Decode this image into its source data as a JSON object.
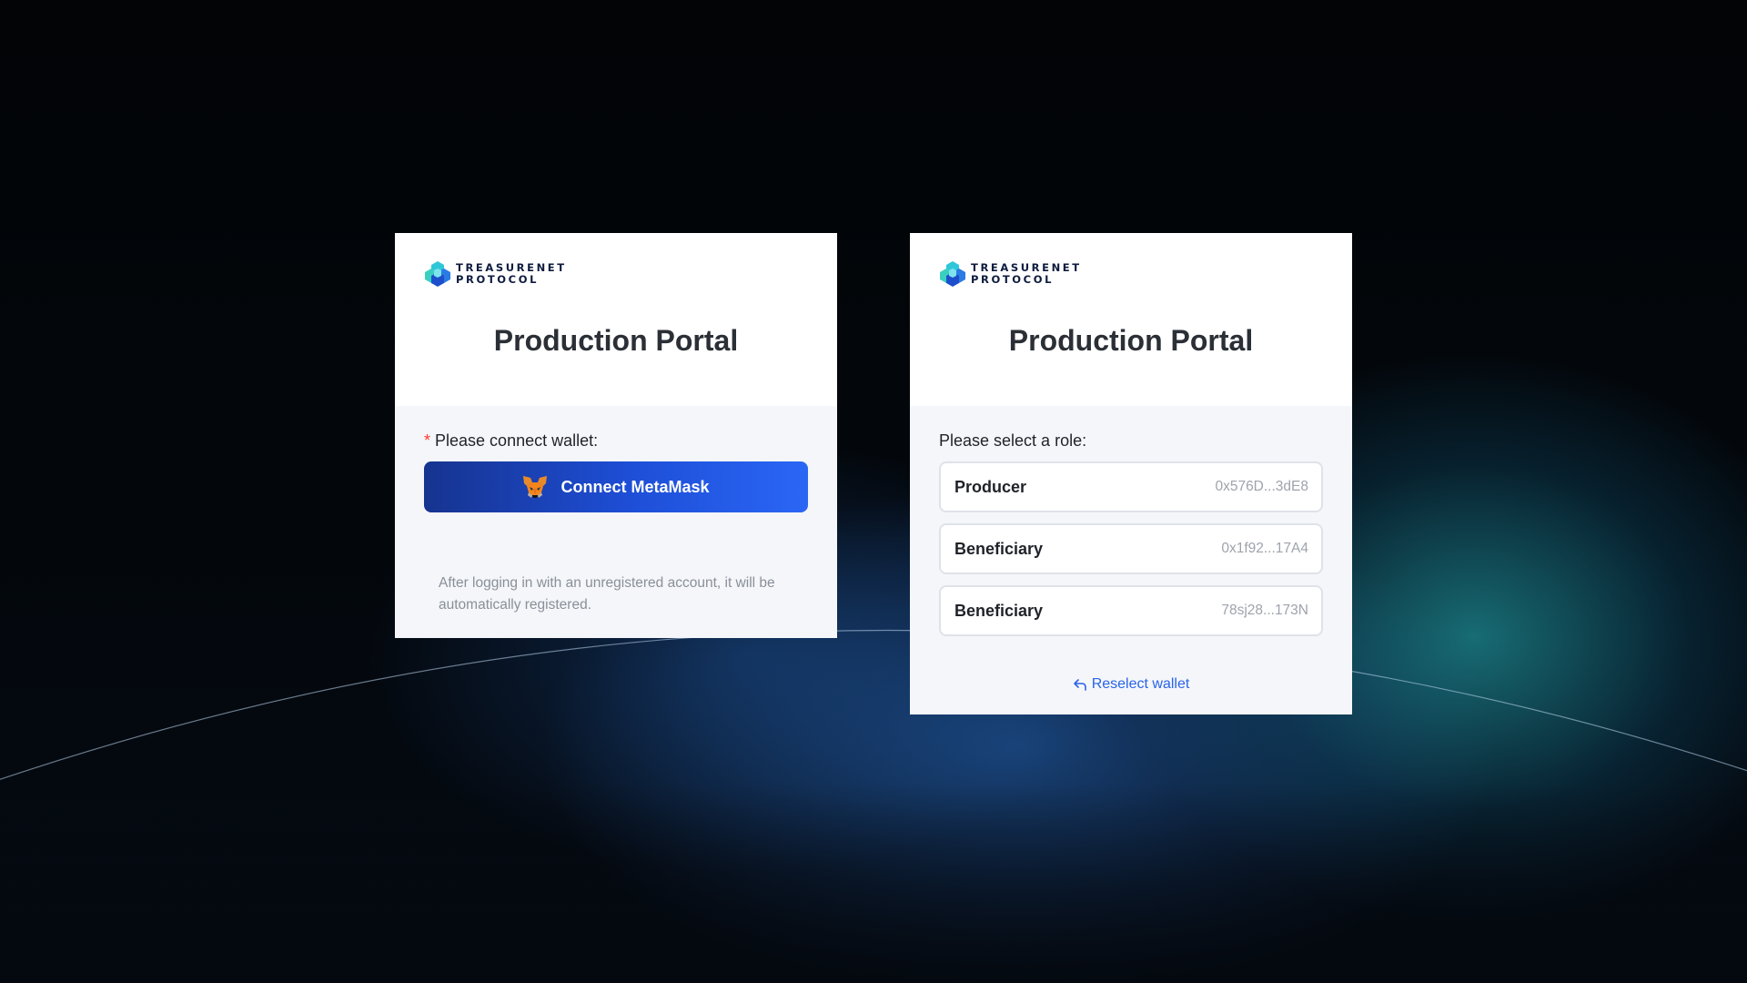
{
  "brand": {
    "logo_line1": "TREASURENET",
    "logo_line2": "PROTOCOL",
    "accent": "#1e4fd8",
    "link_color": "#2a63e8"
  },
  "left_card": {
    "title": "Production Portal",
    "required_mark": "*",
    "field_label": "Please connect wallet:",
    "connect_button": "Connect MetaMask",
    "connect_icon": "metamask-fox-icon",
    "note": "After logging in with an unregistered account, it will be automatically registered."
  },
  "right_card": {
    "title": "Production Portal",
    "field_label": "Please select a role:",
    "roles": [
      {
        "name": "Producer",
        "address": "0x576D...3dE8"
      },
      {
        "name": "Beneficiary",
        "address": "0x1f92...17A4"
      },
      {
        "name": "Beneficiary",
        "address": "78sj28...173N"
      }
    ],
    "reselect_label": "Reselect wallet",
    "reselect_icon": "undo-arrow-icon"
  }
}
